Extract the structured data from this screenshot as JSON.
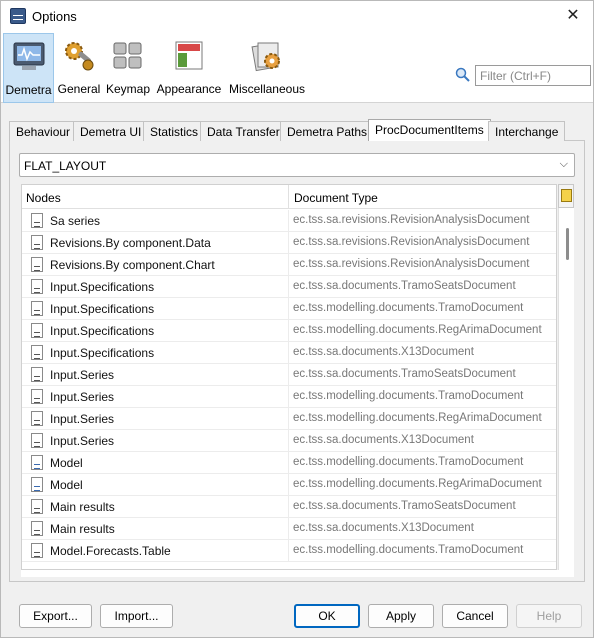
{
  "window": {
    "title": "Options"
  },
  "categories": [
    {
      "label": "Demetra",
      "icon": "monitor-icon",
      "selected": true
    },
    {
      "label": "General",
      "icon": "gears-icon",
      "selected": false
    },
    {
      "label": "Keymap",
      "icon": "keyboard-icon",
      "selected": false
    },
    {
      "label": "Appearance",
      "icon": "appearance-icon",
      "selected": false
    },
    {
      "label": "Miscellaneous",
      "icon": "miscellaneous-icon",
      "selected": false
    }
  ],
  "filter": {
    "placeholder": "Filter (Ctrl+F)"
  },
  "tabs": [
    "Behaviour",
    "Demetra UI",
    "Statistics",
    "Data Transfer",
    "Demetra Paths",
    "ProcDocumentItems",
    "Interchange"
  ],
  "active_tab": "ProcDocumentItems",
  "layout_combo": {
    "value": "FLAT_LAYOUT"
  },
  "table": {
    "columns": [
      "Nodes",
      "Document Type"
    ],
    "rows": [
      {
        "node": "Sa series",
        "doctype": "ec.tss.sa.revisions.RevisionAnalysisDocument",
        "icon": "document-icon"
      },
      {
        "node": "Revisions.By component.Data",
        "doctype": "ec.tss.sa.revisions.RevisionAnalysisDocument",
        "icon": "document-icon"
      },
      {
        "node": "Revisions.By component.Chart",
        "doctype": "ec.tss.sa.revisions.RevisionAnalysisDocument",
        "icon": "document-icon"
      },
      {
        "node": "Input.Specifications",
        "doctype": "ec.tss.sa.documents.TramoSeatsDocument",
        "icon": "document-icon"
      },
      {
        "node": "Input.Specifications",
        "doctype": "ec.tss.modelling.documents.TramoDocument",
        "icon": "document-icon"
      },
      {
        "node": "Input.Specifications",
        "doctype": "ec.tss.modelling.documents.RegArimaDocument",
        "icon": "document-icon"
      },
      {
        "node": "Input.Specifications",
        "doctype": "ec.tss.sa.documents.X13Document",
        "icon": "document-icon"
      },
      {
        "node": "Input.Series",
        "doctype": "ec.tss.sa.documents.TramoSeatsDocument",
        "icon": "document-icon"
      },
      {
        "node": "Input.Series",
        "doctype": "ec.tss.modelling.documents.TramoDocument",
        "icon": "document-icon"
      },
      {
        "node": "Input.Series",
        "doctype": "ec.tss.modelling.documents.RegArimaDocument",
        "icon": "document-icon"
      },
      {
        "node": "Input.Series",
        "doctype": "ec.tss.sa.documents.X13Document",
        "icon": "document-icon"
      },
      {
        "node": "Model",
        "doctype": "ec.tss.modelling.documents.TramoDocument",
        "icon": "model-document-icon"
      },
      {
        "node": "Model",
        "doctype": "ec.tss.modelling.documents.RegArimaDocument",
        "icon": "model-document-icon"
      },
      {
        "node": "Main results",
        "doctype": "ec.tss.sa.documents.TramoSeatsDocument",
        "icon": "document-icon"
      },
      {
        "node": "Main results",
        "doctype": "ec.tss.sa.documents.X13Document",
        "icon": "document-icon"
      },
      {
        "node": "Model.Forecasts.Table",
        "doctype": "ec.tss.modelling.documents.TramoDocument",
        "icon": "document-icon"
      }
    ]
  },
  "buttons": {
    "export": "Export...",
    "import": "Import...",
    "ok": "OK",
    "apply": "Apply",
    "cancel": "Cancel",
    "help": "Help"
  },
  "colors": {
    "accent": "#0067c0",
    "selection": "#cde4f7"
  }
}
